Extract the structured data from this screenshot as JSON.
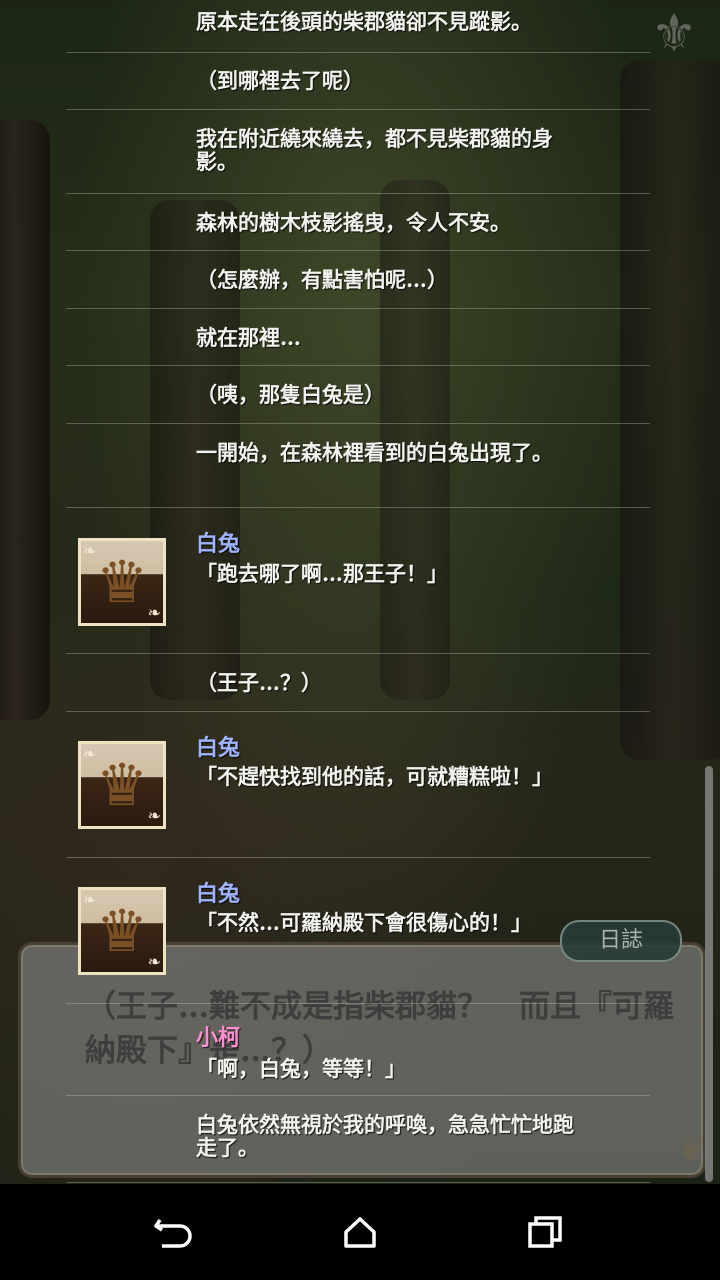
{
  "log": {
    "entries": [
      {
        "type": "narration",
        "text": "原本走在後頭的柴郡貓卻不見蹤影。"
      },
      {
        "type": "narration",
        "text": "（到哪裡去了呢）"
      },
      {
        "type": "narration",
        "text": "我在附近繞來繞去，都不見柴郡貓的身影。"
      },
      {
        "type": "narration",
        "text": "森林的樹木枝影搖曳，令人不安。"
      },
      {
        "type": "narration",
        "text": "（怎麼辦，有點害怕呢…）"
      },
      {
        "type": "narration",
        "text": "就在那裡…"
      },
      {
        "type": "narration",
        "text": "（咦，那隻白兔是）"
      },
      {
        "type": "narration",
        "text": "一開始，在森林裡看到的白兔出現了。"
      },
      {
        "type": "dialogue",
        "speaker": "白兔",
        "text": "「跑去哪了啊…那王子！」"
      },
      {
        "type": "narration",
        "text": "（王子…？）"
      },
      {
        "type": "dialogue",
        "speaker": "白兔",
        "text": "「不趕快找到他的話，可就糟糕啦！」"
      },
      {
        "type": "dialogue",
        "speaker": "白兔",
        "text": "「不然…可羅納殿下會很傷心的！」"
      },
      {
        "type": "dialogue",
        "speaker": "小柯",
        "text": "「啊，白兔，等等！」"
      },
      {
        "type": "narration",
        "text": "白兔依然無視於我的呼喚，急急忙忙地跑走了。"
      }
    ]
  },
  "dialogue_box": {
    "text": "（王子…難不成是指柴郡貓？　而且『可羅納殿下』是…？）",
    "log_button": "日誌"
  },
  "colors": {
    "speaker_white_rabbit": "#9fb4ff",
    "speaker_ko": "#ff8fd0"
  },
  "icons": {
    "avatar": "crown-icon",
    "nav": [
      "back-icon",
      "home-icon",
      "recents-icon"
    ]
  }
}
